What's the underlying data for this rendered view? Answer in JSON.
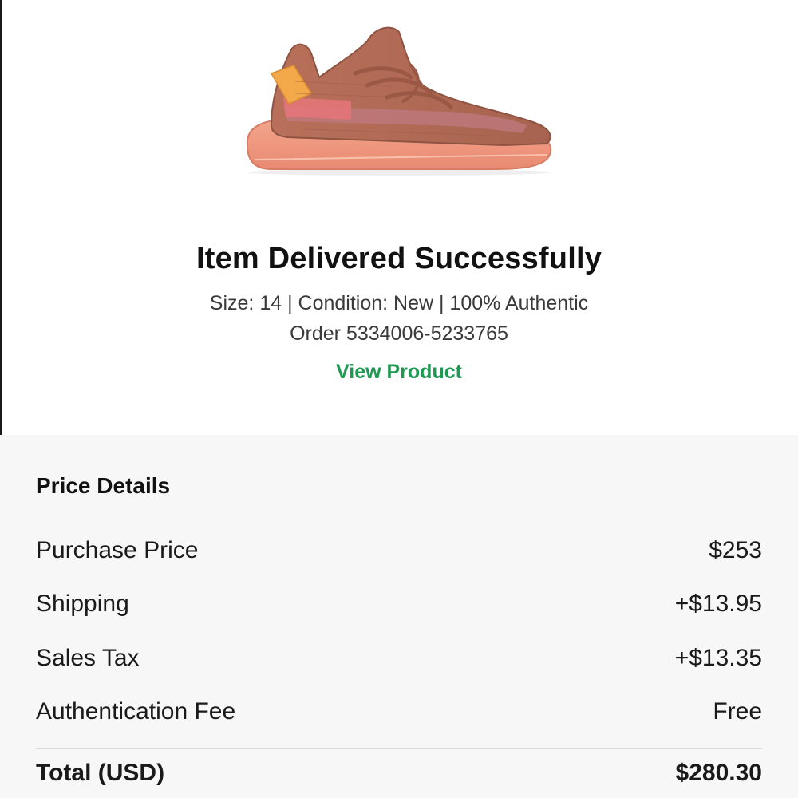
{
  "order": {
    "status_title": "Item Delivered Successfully",
    "details_line": "Size: 14 | Condition: New | 100% Authentic",
    "order_line": "Order 5334006-5233765",
    "view_product_label": "View Product",
    "product_image_icon": "sneaker-image"
  },
  "price_details": {
    "heading": "Price Details",
    "rows": [
      {
        "label": "Purchase Price",
        "value": "$253"
      },
      {
        "label": "Shipping",
        "value": "+$13.95"
      },
      {
        "label": "Sales Tax",
        "value": "+$13.35"
      },
      {
        "label": "Authentication Fee",
        "value": "Free"
      }
    ],
    "total": {
      "label": "Total (USD)",
      "value": "$280.30"
    }
  },
  "colors": {
    "link_green": "#1f9a53",
    "section_bg": "#f7f7f7"
  }
}
